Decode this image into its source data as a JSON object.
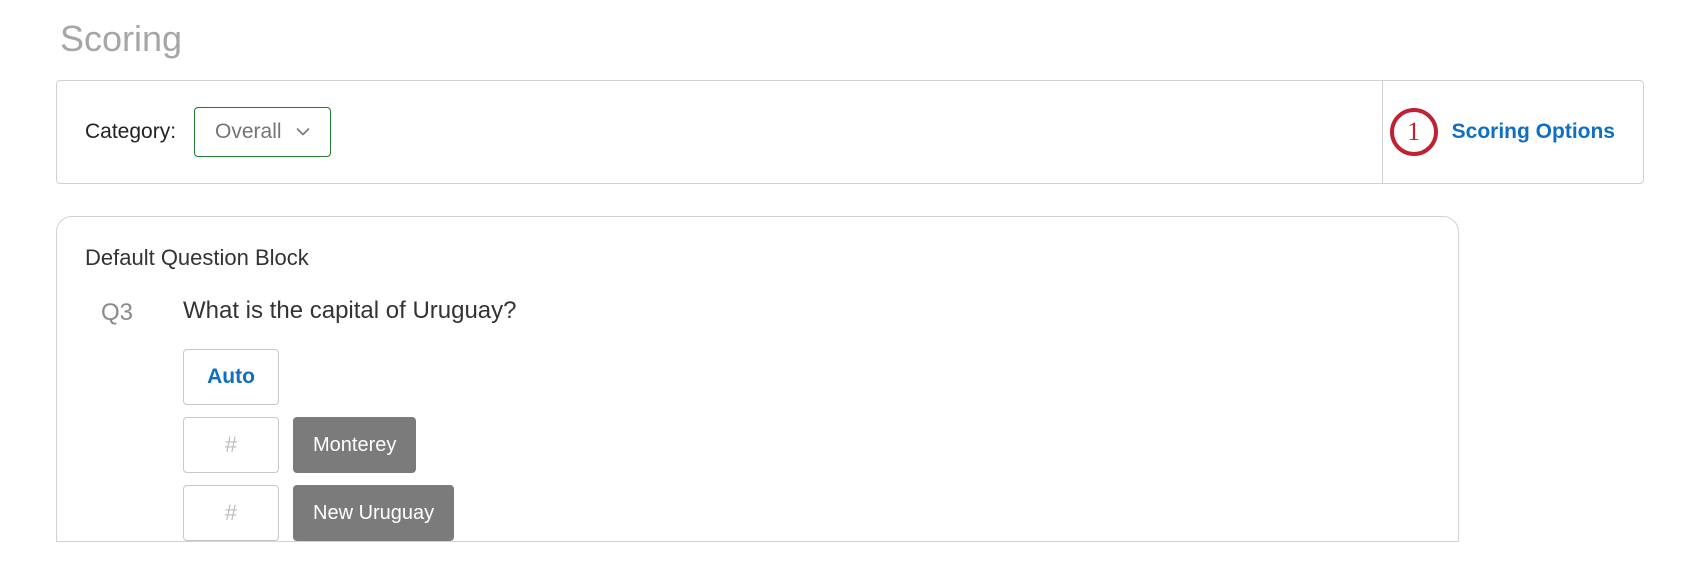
{
  "page": {
    "title": "Scoring"
  },
  "category": {
    "label": "Category:",
    "value": "Overall"
  },
  "callout": {
    "number": "1"
  },
  "scoring_options_label": "Scoring Options",
  "block": {
    "title": "Default Question Block",
    "question": {
      "id": "Q3",
      "text": "What is the capital of Uruguay?",
      "auto_label": "Auto",
      "score_placeholder": "#",
      "choices": [
        {
          "label": "Monterey"
        },
        {
          "label": "New Uruguay"
        }
      ]
    }
  }
}
